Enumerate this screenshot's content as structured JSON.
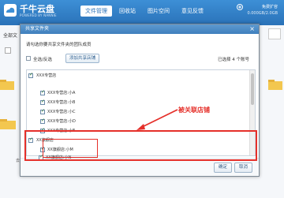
{
  "app": {
    "logo_text": "千牛云盘",
    "logo_sub": "POWERED BY NANNIE",
    "nav_tabs": [
      "文件管理",
      "回收站",
      "图片空间",
      "意见反馈"
    ],
    "header_line1": "免费扩容",
    "header_line2": "0.000GB/2.0GB"
  },
  "background": {
    "left_label": "全部文",
    "left_bottom": "去"
  },
  "dialog": {
    "title": "共享文件夹",
    "close": "×",
    "instruction": "请勾选你要共享文件夹的团队成员",
    "select_all": "全选/反选",
    "add_shop_button": "添加共享店铺",
    "selected_count": "已选择 4 个账号",
    "ok_button": "确定",
    "cancel_button": "取消"
  },
  "tree": [
    {
      "label": "XXX专营店",
      "checked": true,
      "level": 0,
      "expandable": true
    },
    {
      "label": "XXX专营店:小A",
      "checked": true,
      "level": 1
    },
    {
      "label": "XXX专营店:小B",
      "checked": true,
      "level": 1
    },
    {
      "label": "XXX专营店:小C",
      "checked": true,
      "level": 1
    },
    {
      "label": "XXX专营店:小D",
      "checked": true,
      "level": 1
    },
    {
      "label": "XXX专营店:小E",
      "checked": true,
      "level": 1
    },
    {
      "label": "XX旗舰店",
      "checked": true,
      "level": 0,
      "expandable": true
    },
    {
      "label": "XX旗舰店:小M",
      "checked": true,
      "level": 1
    },
    {
      "label": "XX旗舰店:小N",
      "checked": true,
      "level": 1
    }
  ],
  "annotation": "被关联店铺",
  "colors": {
    "accent": "#2a72b8",
    "highlight": "#e5302a"
  }
}
